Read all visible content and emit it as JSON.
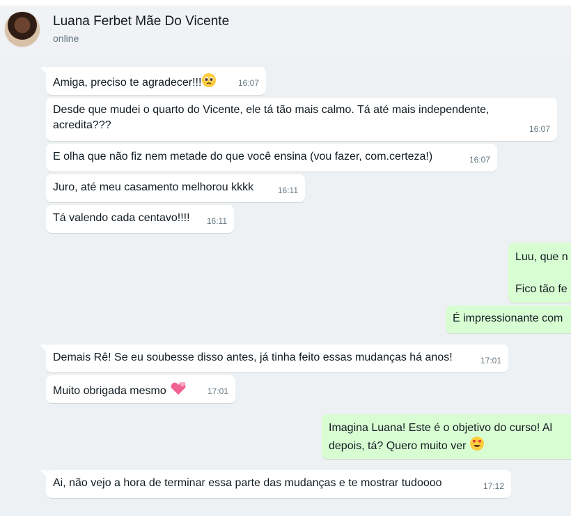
{
  "header": {
    "contact_name": "Luana Ferbet Mãe Do Vicente",
    "status": "online"
  },
  "messages": [
    {
      "text": "Amiga, preciso te agradecer!!!",
      "time": "16:07"
    },
    {
      "text": "Desde que mudei o quarto do Vicente, ele tá tão mais calmo. Tá até mais independente, acredita???",
      "time": "16:07"
    },
    {
      "text": "E olha que não fiz nem metade do que você ensina (vou fazer, com.certeza!)",
      "time": "16:07"
    },
    {
      "text": "Juro, até meu casamento melhorou kkkk",
      "time": "16:11"
    },
    {
      "text": "Tá valendo cada centavo!!!!",
      "time": "16:11"
    },
    {
      "line1": "Luu, que n",
      "line2": "Fico tão fe"
    },
    {
      "text": "É impressionante com"
    },
    {
      "text": "Demais Rê! Se eu soubesse disso antes, já tinha feito essas mudanças há anos!",
      "time": "17:01"
    },
    {
      "text": "Muito obrigada mesmo",
      "time": "17:01"
    },
    {
      "line1": "Imagina Luana! Este é o objetivo do curso! Al",
      "line2": "depois, tá? Quero muito ver"
    },
    {
      "text": "Ai, não vejo a hora de terminar essa parte das mudanças e te mostrar tudoooo",
      "time": "17:12"
    }
  ],
  "icons": {
    "pleading_face": "pleading-face-emoji",
    "heart": "revolving-hearts-emoji",
    "heart_eyes": "heart-eyes-emoji"
  },
  "colors": {
    "incoming_bubble": "#ffffff",
    "outgoing_bubble": "#d9fdd3",
    "chat_background": "#eef1f3",
    "header_background": "#f0f2f5"
  }
}
